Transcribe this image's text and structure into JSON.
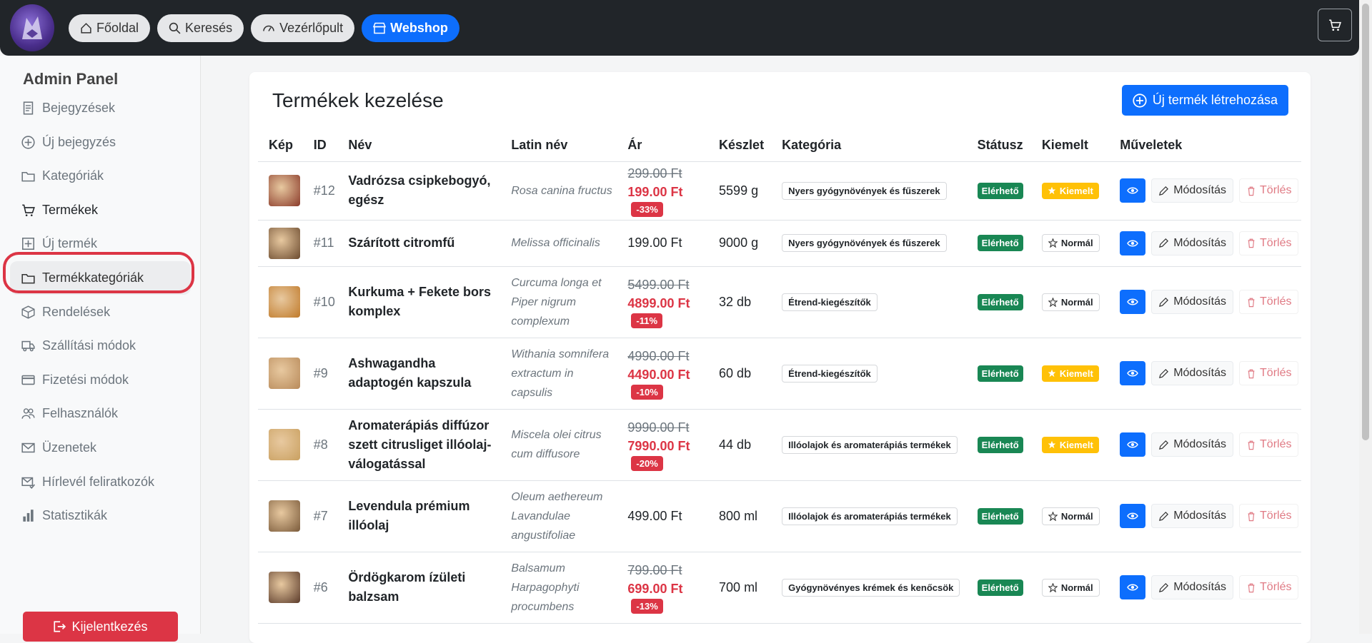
{
  "nav": {
    "home": "Főoldal",
    "search": "Keresés",
    "dashboard": "Vezérlőpult",
    "webshop": "Webshop"
  },
  "sidebar": {
    "title": "Admin Panel",
    "items": [
      {
        "label": "Bejegyzések",
        "icon": "document-icon"
      },
      {
        "label": "Új bejegyzés",
        "icon": "plus-circle-icon"
      },
      {
        "label": "Kategóriák",
        "icon": "folder-icon"
      },
      {
        "label": "Termékek",
        "icon": "cart-icon"
      },
      {
        "label": "Új termék",
        "icon": "plus-square-icon"
      },
      {
        "label": "Termékkategóriák",
        "icon": "folder-icon"
      },
      {
        "label": "Rendelések",
        "icon": "box-icon"
      },
      {
        "label": "Szállítási módok",
        "icon": "truck-icon"
      },
      {
        "label": "Fizetési módok",
        "icon": "credit-card-icon"
      },
      {
        "label": "Felhasználók",
        "icon": "users-icon"
      },
      {
        "label": "Üzenetek",
        "icon": "envelope-icon"
      },
      {
        "label": "Hírlevél feliratkozók",
        "icon": "envelope-check-icon"
      },
      {
        "label": "Statisztikák",
        "icon": "bar-chart-icon"
      }
    ],
    "logout": "Kijelentkezés"
  },
  "main": {
    "title": "Termékek kezelése",
    "new_button": "Új termék létrehozása",
    "columns": [
      "Kép",
      "ID",
      "Név",
      "Latin név",
      "Ár",
      "Készlet",
      "Kategória",
      "Státusz",
      "Kiemelt",
      "Műveletek"
    ],
    "edit_label": "Módosítás",
    "delete_label": "Törlés",
    "rows": [
      {
        "id": "#12",
        "name": "Vadrózsa csipkebogyó, egész",
        "latin": "Rosa canina fructus",
        "old_price": "299.00 Ft",
        "price": "199.00 Ft",
        "discount": "-33%",
        "stock": "5599 g",
        "category": "Nyers gyógynövények és fűszerek",
        "status": "Elérhető",
        "featured": "Kiemelt",
        "thumb": "#8a3a2a"
      },
      {
        "id": "#11",
        "name": "Szárított citromfű",
        "latin": "Melissa officinalis",
        "old_price": "",
        "price": "199.00 Ft",
        "discount": "",
        "stock": "9000 g",
        "category": "Nyers gyógynövények és fűszerek",
        "status": "Elérhető",
        "featured": "Normál",
        "thumb": "#6b4a2e"
      },
      {
        "id": "#10",
        "name": "Kurkuma + Fekete bors komplex",
        "latin": "Curcuma longa et Piper nigrum complexum",
        "old_price": "5499.00 Ft",
        "price": "4899.00 Ft",
        "discount": "-11%",
        "stock": "32 db",
        "category": "Étrend-kiegészítők",
        "status": "Elérhető",
        "featured": "Normál",
        "thumb": "#c07a2a"
      },
      {
        "id": "#9",
        "name": "Ashwagandha adaptogén kapszula",
        "latin": "Withania somnifera extractum in capsulis",
        "old_price": "4990.00 Ft",
        "price": "4490.00 Ft",
        "discount": "-10%",
        "stock": "60 db",
        "category": "Étrend-kiegészítők",
        "status": "Elérhető",
        "featured": "Kiemelt",
        "thumb": "#b88a5a"
      },
      {
        "id": "#8",
        "name": "Aromaterápiás diffúzor szett citrusliget illóolaj-válogatással",
        "latin": "Miscela olei citrus cum diffusore",
        "old_price": "9990.00 Ft",
        "price": "7990.00 Ft",
        "discount": "-20%",
        "stock": "44 db",
        "category": "Illóolajok és aromaterápiás termékek",
        "status": "Elérhető",
        "featured": "Kiemelt",
        "thumb": "#c9a060"
      },
      {
        "id": "#7",
        "name": "Levendula prémium illóolaj",
        "latin": "Oleum aethereum Lavandulae angustifoliae",
        "old_price": "",
        "price": "499.00 Ft",
        "discount": "",
        "stock": "800 ml",
        "category": "Illóolajok és aromaterápiás termékek",
        "status": "Elérhető",
        "featured": "Normál",
        "thumb": "#7a5a3a"
      },
      {
        "id": "#6",
        "name": "Ördögkarom ízületi balzsam",
        "latin": "Balsamum Harpagophyti procumbens",
        "old_price": "799.00 Ft",
        "price": "699.00 Ft",
        "discount": "-13%",
        "stock": "700 ml",
        "category": "Gyógynövényes krémek és kenőcsök",
        "status": "Elérhető",
        "featured": "Normál",
        "thumb": "#5a3a2a"
      }
    ]
  },
  "colors": {
    "primary": "#0d6efd",
    "danger": "#dc3545",
    "success": "#198754",
    "warning": "#ffc107",
    "topbar": "#212529"
  }
}
